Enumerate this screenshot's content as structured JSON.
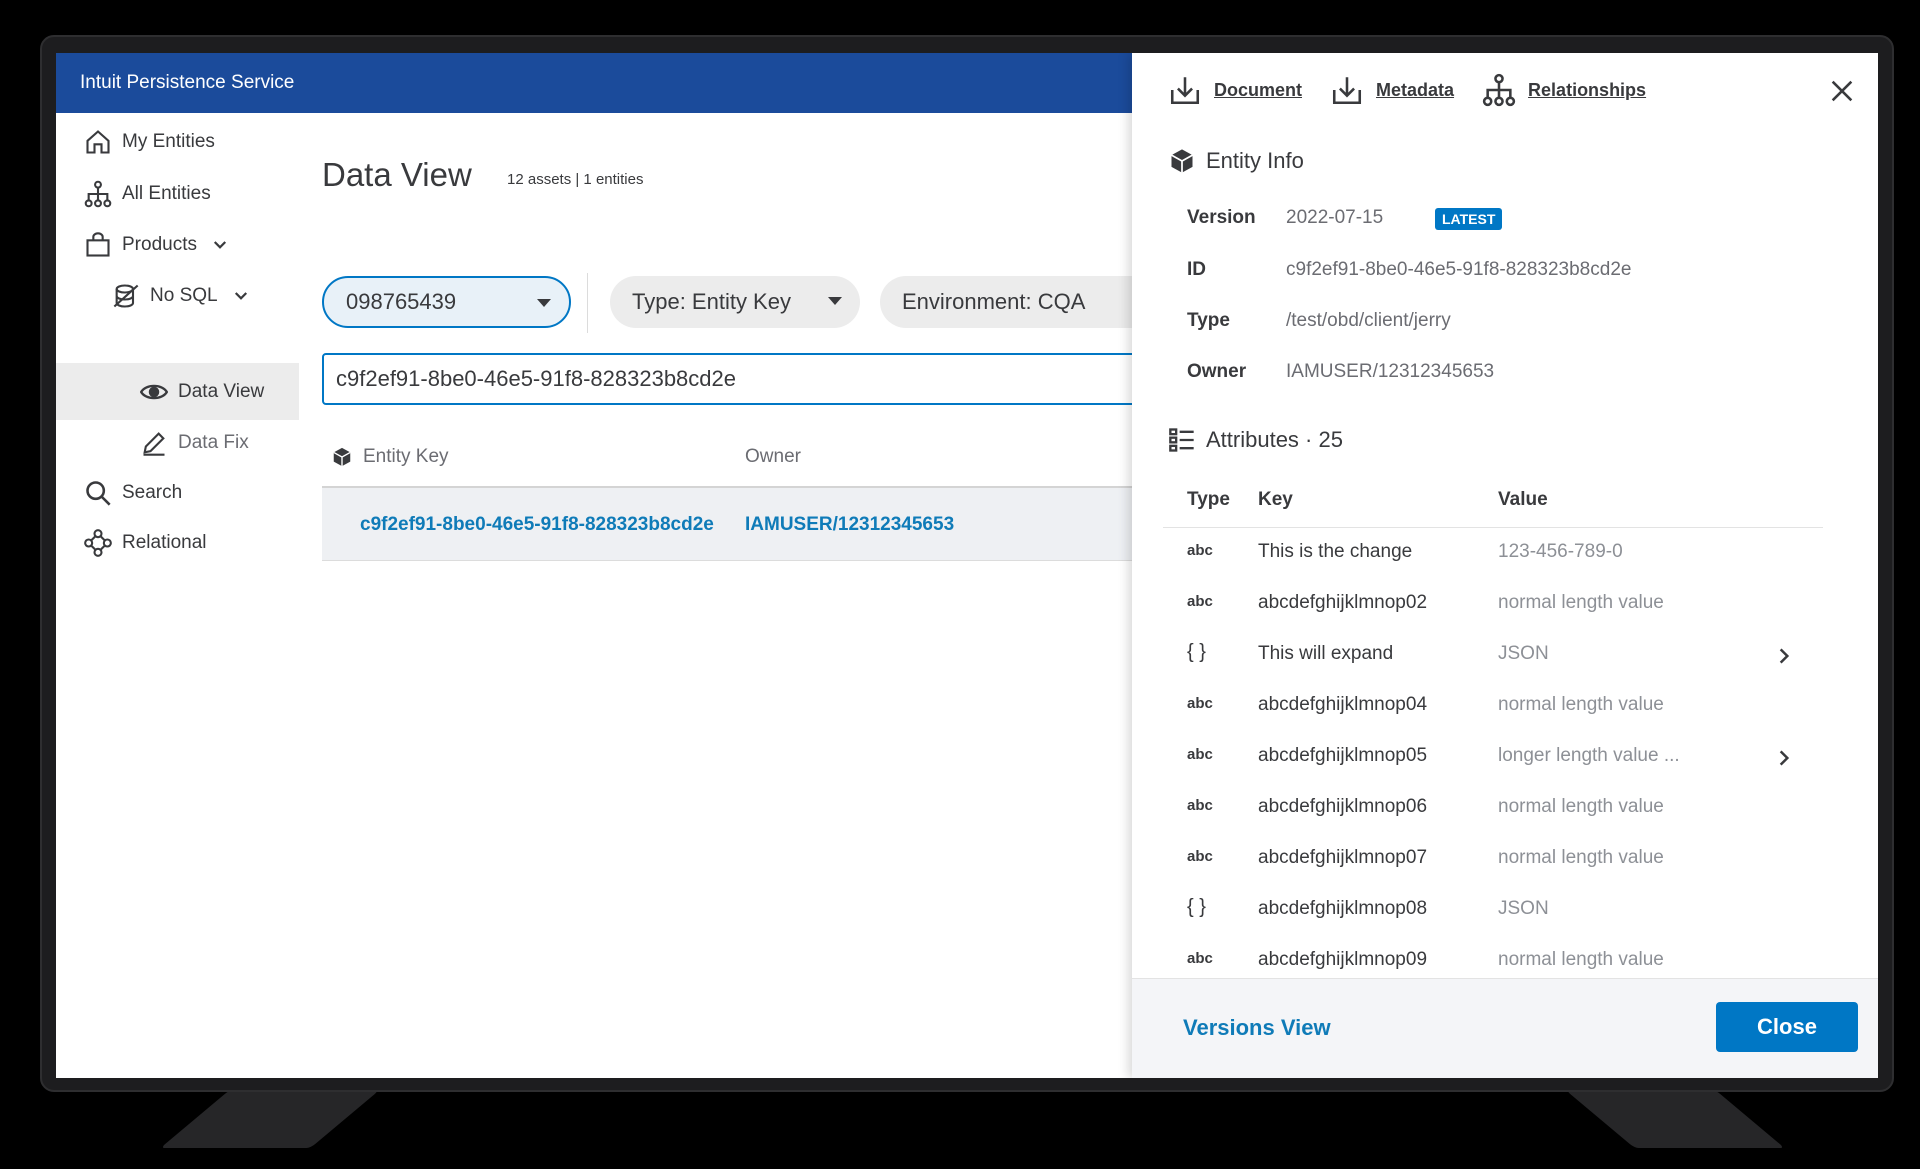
{
  "app": {
    "title": "Intuit Persistence Service"
  },
  "sidebar": {
    "items": [
      {
        "label": "My Entities",
        "icon": "home-icon"
      },
      {
        "label": "All Entities",
        "icon": "hierarchy-icon"
      },
      {
        "label": "Products",
        "icon": "shopping-bag-icon"
      },
      {
        "label": "No SQL",
        "icon": "database-icon"
      },
      {
        "label": "Data View",
        "icon": "eye-icon"
      },
      {
        "label": "Data Fix",
        "icon": "pencil-icon"
      },
      {
        "label": "Search",
        "icon": "search-icon"
      },
      {
        "label": "Relational",
        "icon": "relational-icon"
      }
    ]
  },
  "main": {
    "title": "Data View",
    "subtitle": "12 assets | 1 entities",
    "filters": {
      "account": "098765439",
      "type": "Type: Entity Key",
      "environment": "Environment: CQA"
    },
    "search_value": "c9f2ef91-8be0-46e5-91f8-828323b8cd2e",
    "table": {
      "columns": [
        "Entity Key",
        "Owner"
      ],
      "rows": [
        {
          "entity_key": "c9f2ef91-8be0-46e5-91f8-828323b8cd2e",
          "owner": "IAMUSER/12312345653"
        }
      ]
    }
  },
  "panel": {
    "tabs": [
      "Document",
      "Metadata",
      "Relationships"
    ],
    "entity_info": {
      "heading": "Entity Info",
      "version_label": "Version",
      "version": "2022-07-15",
      "badge": "LATEST",
      "id_label": "ID",
      "id": "c9f2ef91-8be0-46e5-91f8-828323b8cd2e",
      "type_label": "Type",
      "type": "/test/obd/client/jerry",
      "owner_label": "Owner",
      "owner": "IAMUSER/12312345653"
    },
    "attributes": {
      "heading": "Attributes · 25",
      "columns": [
        "Type",
        "Key",
        "Value"
      ],
      "rows": [
        {
          "type": "abc",
          "key": "This is the change",
          "value": "123-456-789-0"
        },
        {
          "type": "abc",
          "key": "abcdefghijklmnop02",
          "value": "normal length value"
        },
        {
          "type": "{ }",
          "key": "This will expand",
          "value": "JSON"
        },
        {
          "type": "abc",
          "key": "abcdefghijklmnop04",
          "value": "normal length value"
        },
        {
          "type": "abc",
          "key": "abcdefghijklmnop05",
          "value": "longer length value ..."
        },
        {
          "type": "abc",
          "key": "abcdefghijklmnop06",
          "value": "normal length value"
        },
        {
          "type": "abc",
          "key": "abcdefghijklmnop07",
          "value": "normal length value"
        },
        {
          "type": "{ }",
          "key": "abcdefghijklmnop08",
          "value": "JSON"
        },
        {
          "type": "abc",
          "key": "abcdefghijklmnop09",
          "value": "normal length value"
        }
      ]
    },
    "footer": {
      "versions_link": "Versions View",
      "close_label": "Close"
    }
  },
  "colors": {
    "banner": "#1b4b9b",
    "accent": "#0077c5",
    "link": "#0f7bb8"
  }
}
